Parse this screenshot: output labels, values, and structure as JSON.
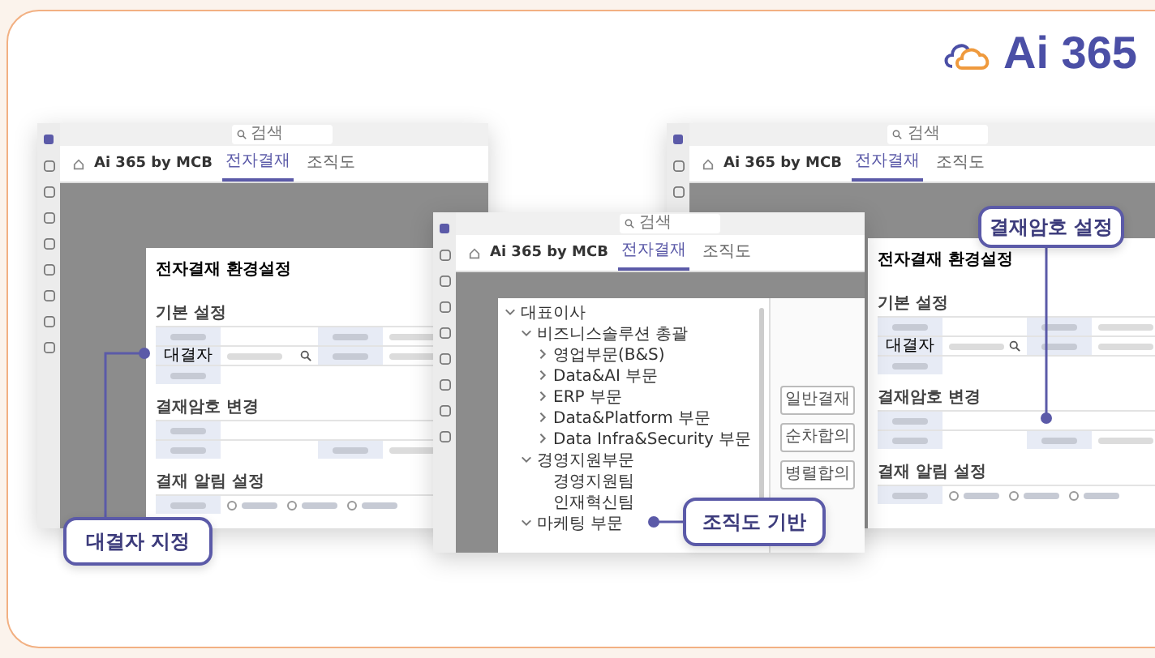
{
  "logo": {
    "text": "Ai 365"
  },
  "windows": [
    {
      "kind": "settings",
      "search": "검색",
      "app_title": "Ai 365 by MCB",
      "tabs": [
        {
          "label": "전자결재",
          "selected": true
        },
        {
          "label": "조직도",
          "selected": false
        }
      ],
      "dialog_title": "전자결재 환경설정",
      "sections": [
        {
          "title": "기본 설정",
          "rows": [
            {
              "kind": "pair"
            },
            {
              "kind": "search",
              "label": "대결자"
            },
            {
              "kind": "single"
            }
          ]
        },
        {
          "title": "결재암호 변경",
          "rows": [
            {
              "kind": "single"
            },
            {
              "kind": "pair"
            }
          ]
        },
        {
          "title": "결재 알림 설정",
          "rows": [
            {
              "kind": "radio",
              "options": [
                {
                  "selected": false
                },
                {
                  "selected": false
                },
                {
                  "selected": false
                }
              ]
            }
          ]
        }
      ],
      "callout": "대결자 지정"
    },
    {
      "kind": "org",
      "search": "검색",
      "app_title": "Ai 365 by MCB",
      "tabs": [
        {
          "label": "전자결재",
          "selected": true
        },
        {
          "label": "조직도",
          "selected": false
        }
      ],
      "tree": [
        {
          "label": "대표이사",
          "expanded": true,
          "children": [
            {
              "label": "비즈니스솔루션 총괄",
              "expanded": true,
              "children": [
                {
                  "label": "영업부문(B&S)",
                  "expanded": false
                },
                {
                  "label": "Data&AI 부문",
                  "expanded": false
                },
                {
                  "label": "ERP 부문",
                  "expanded": false
                },
                {
                  "label": "Data&Platform 부문",
                  "expanded": false
                },
                {
                  "label": "Data Infra&Security 부문",
                  "expanded": false
                }
              ]
            },
            {
              "label": "경영지원부문",
              "expanded": true,
              "children": [
                {
                  "label": "경영지원팀"
                },
                {
                  "label": "인재혁신팀"
                }
              ]
            },
            {
              "label": "마케팅 부문",
              "expanded": true
            }
          ]
        }
      ],
      "buttons": [
        "일반결재",
        "순차합의",
        "병렬합의"
      ],
      "callout": "조직도 기반"
    },
    {
      "kind": "settings",
      "search": "검색",
      "app_title": "Ai 365 by MCB",
      "tabs": [
        {
          "label": "전자결재",
          "selected": true
        },
        {
          "label": "조직도",
          "selected": false
        }
      ],
      "dialog_title": "전자결재 환경설정",
      "sections": [
        {
          "title": "기본 설정",
          "rows": [
            {
              "kind": "pair"
            },
            {
              "kind": "search",
              "label": "대결자"
            },
            {
              "kind": "single"
            }
          ]
        },
        {
          "title": "결재암호 변경",
          "rows": [
            {
              "kind": "single"
            },
            {
              "kind": "pair"
            }
          ]
        },
        {
          "title": "결재 알림 설정",
          "rows": [
            {
              "kind": "radio",
              "options": [
                {
                  "selected": false
                },
                {
                  "selected": false
                },
                {
                  "selected": false
                }
              ]
            }
          ]
        }
      ],
      "callout": "결재암호 설정"
    }
  ]
}
